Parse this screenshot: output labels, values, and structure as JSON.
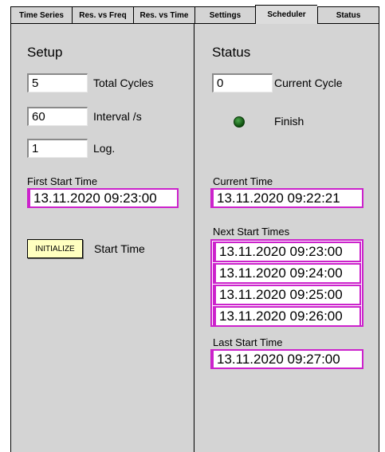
{
  "tabs": [
    {
      "label": "Time Series",
      "active": false
    },
    {
      "label": "Res. vs Freq",
      "active": false
    },
    {
      "label": "Res. vs Time",
      "active": false
    },
    {
      "label": "Settings",
      "active": false
    },
    {
      "label": "Scheduler",
      "active": true
    },
    {
      "label": "Status",
      "active": false
    }
  ],
  "setup": {
    "heading": "Setup",
    "total_cycles": {
      "value": "5",
      "label": "Total Cycles"
    },
    "interval": {
      "value": "60",
      "label": "Interval /s"
    },
    "log": {
      "value": "1",
      "label": "Log."
    },
    "first_start_label": "First Start Time",
    "first_start_value": "13.11.2020 09:23:00",
    "initialize_button": "INITIALIZE",
    "start_time_label": "Start Time"
  },
  "status": {
    "heading": "Status",
    "current_cycle": {
      "value": "0",
      "label": "Current Cycle"
    },
    "finish_label": "Finish",
    "finish_led_color": "#1a6b1a",
    "current_time_label": "Current Time",
    "current_time_value": "13.11.2020 09:22:21",
    "next_start_label": "Next Start Times",
    "next_start_times": [
      "13.11.2020 09:23:00",
      "13.11.2020 09:24:00",
      "13.11.2020 09:25:00",
      "13.11.2020 09:26:00"
    ],
    "last_start_label": "Last Start Time",
    "last_start_value": "13.11.2020 09:27:00"
  },
  "colors": {
    "panel_bg": "#d4d4d4",
    "time_border": "#cc22cc",
    "button_bg": "#ffffc0"
  }
}
